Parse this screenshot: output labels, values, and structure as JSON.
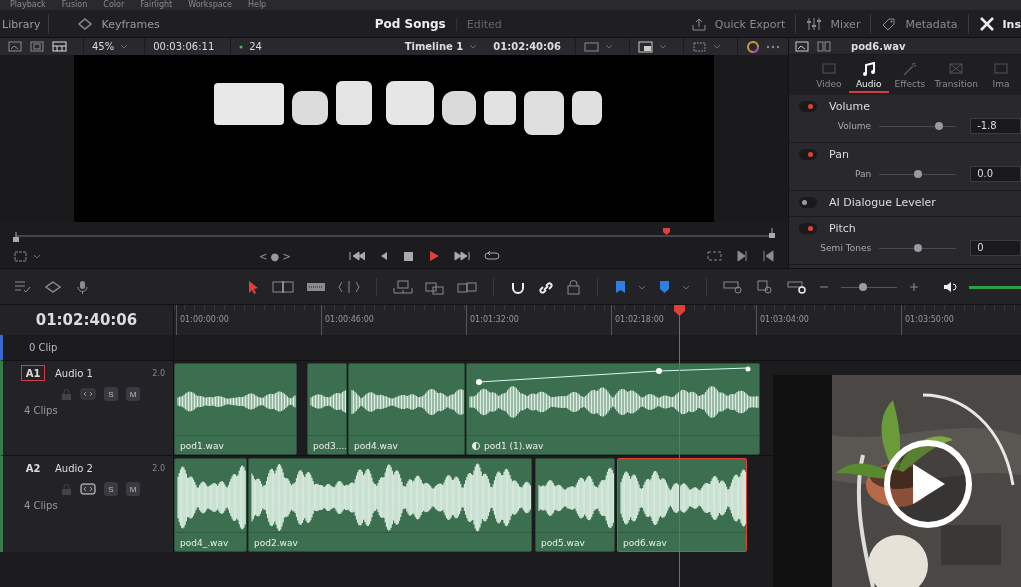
{
  "menu": [
    "Playback",
    "Fusion",
    "Color",
    "Fairlight",
    "Workspace",
    "Help"
  ],
  "header": {
    "left": [
      "Library",
      "Keyframes"
    ],
    "project": "Pod Songs",
    "status": "Edited",
    "right": [
      "Quick Export",
      "Mixer",
      "Metadata",
      "Ins"
    ]
  },
  "viewer": {
    "zoom": "45%",
    "duration": "00:03:06:11",
    "fps": "24",
    "timeline": "Timeline 1",
    "timecode": "01:02:40:06",
    "scrubber": {
      "level": 0.86
    },
    "nav": "< ● >"
  },
  "inspector": {
    "clip": "pod6.wav",
    "tabs": [
      {
        "label": "Video",
        "selected": false
      },
      {
        "label": "Audio",
        "selected": true
      },
      {
        "label": "Effects",
        "selected": false
      },
      {
        "label": "Transition",
        "selected": false
      },
      {
        "label": "Ima",
        "selected": false
      }
    ],
    "sections": [
      {
        "title": "Volume",
        "on": true,
        "params": [
          {
            "label": "Volume",
            "level": 0.78,
            "value": "-1.8"
          }
        ]
      },
      {
        "title": "Pan",
        "on": true,
        "params": [
          {
            "label": "Pan",
            "level": 0.51,
            "value": "0.0"
          }
        ]
      },
      {
        "title": "AI Dialogue Leveler",
        "on": false
      },
      {
        "title": "Pitch",
        "on": true,
        "params": [
          {
            "label": "Semi Tones",
            "level": 0.5,
            "value": "0"
          }
        ]
      }
    ]
  },
  "timeline_toolbar": {
    "zoom": {
      "level": 0.4
    }
  },
  "timeline": {
    "timecode": "01:02:40:06",
    "ruler": [
      "01:00:00:00",
      "01:00:46:00",
      "01:01:32:00",
      "01:02:18:00",
      "01:03:04:00",
      "01:03:50:00"
    ],
    "clip_count": "0 Clip",
    "tracks": [
      {
        "id": "A1",
        "name": "Audio 1",
        "channels": "2.0",
        "buttons": [
          "S",
          "M"
        ],
        "clips_label": "4 Clips",
        "selected": true,
        "clips": [
          {
            "name": "pod1.wav",
            "selected": false
          },
          {
            "name": "pod3....",
            "selected": false
          },
          {
            "name": "pod4.wav",
            "selected": false
          },
          {
            "name": "pod1 (1).wav",
            "selected": false
          }
        ]
      },
      {
        "id": "A2",
        "name": "Audio 2",
        "channels": "2.0",
        "buttons": [
          "S",
          "M"
        ],
        "clips_label": "4 Clips",
        "selected": false,
        "clips": [
          {
            "name": "pod4_.wav",
            "selected": false
          },
          {
            "name": "pod2.wav",
            "selected": false
          },
          {
            "name": "pod5.wav",
            "selected": false
          },
          {
            "name": "pod6.wav",
            "selected": true
          }
        ]
      }
    ]
  }
}
